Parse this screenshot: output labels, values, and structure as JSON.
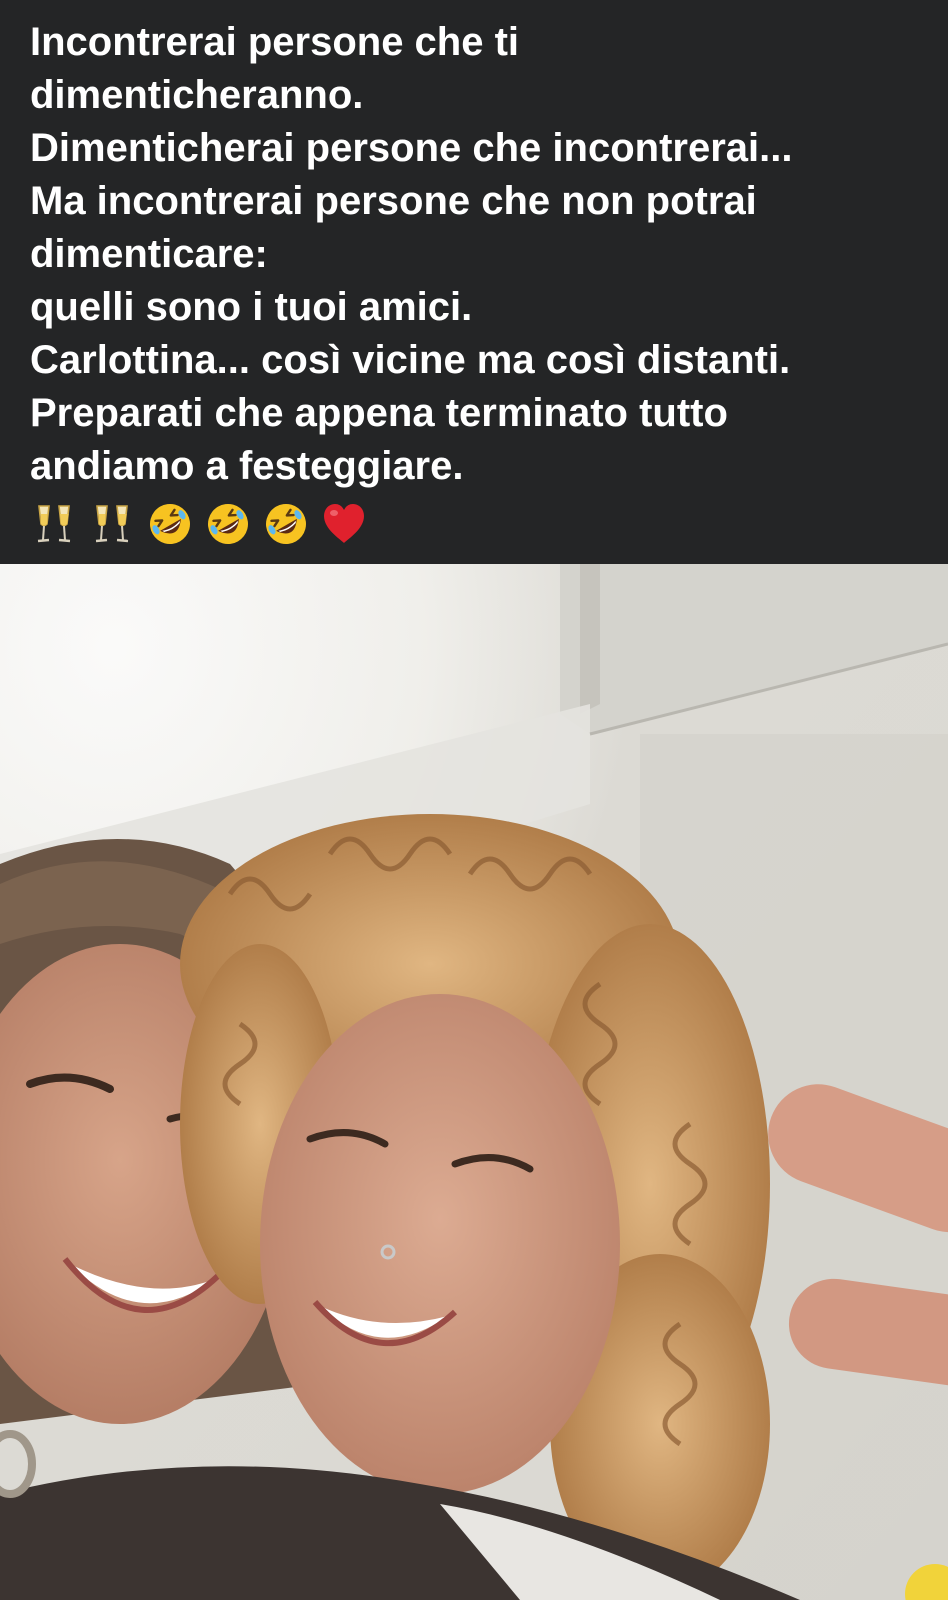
{
  "post": {
    "lines": [
      "Incontrerai persone che ti",
      "dimenticheranno.",
      "Dimenticherai persone che incontrerai...",
      "Ma incontrerai persone che non potrai",
      "dimenticare:",
      "quelli sono i tuoi amici.",
      "Carlottina... così vicine ma così distanti.",
      "Preparati che appena terminato tutto",
      "andiamo a festeggiare."
    ],
    "emojis": [
      "champagne-glasses-icon",
      "champagne-glasses-icon",
      "rolling-on-floor-laughing-icon",
      "rolling-on-floor-laughing-icon",
      "rolling-on-floor-laughing-icon",
      "red-heart-icon"
    ]
  },
  "colors": {
    "background": "#242526",
    "text": "#ffffff",
    "heart": "#e0212d",
    "laugh_face": "#f7c321"
  }
}
